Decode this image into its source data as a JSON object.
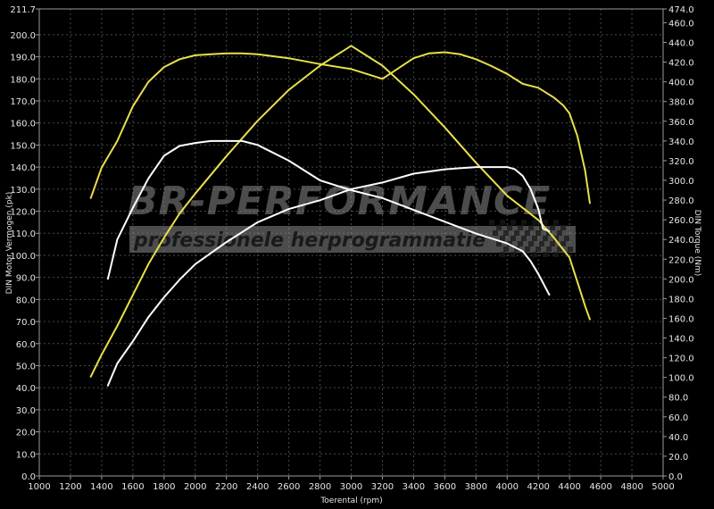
{
  "watermark": {
    "main": "BR-PERFORMANCE",
    "sub": "professionele herprogrammatie"
  },
  "colors": {
    "background": "#000000",
    "tuned": "#e8e04a",
    "stock": "#ffffff",
    "grid": "#4a4a4a"
  },
  "chart_data": {
    "type": "line",
    "xlabel": "Toerental (rpm)",
    "ylabel": "DIN Motor Vermogen (pk)",
    "y2label": "DIN Torque (Nm)",
    "xlim": [
      1000,
      5000
    ],
    "ylim": [
      0,
      211.7
    ],
    "y2lim": [
      0,
      474.0
    ],
    "x_ticks": [
      1000,
      1200,
      1400,
      1600,
      1800,
      2000,
      2200,
      2400,
      2600,
      2800,
      3000,
      3200,
      3400,
      3600,
      3800,
      4000,
      4200,
      4400,
      4600,
      4800,
      5000
    ],
    "y_ticks": [
      "0.0",
      "10.0",
      "20.0",
      "30.0",
      "40.0",
      "50.0",
      "60.0",
      "70.0",
      "80.0",
      "90.0",
      "100.0",
      "110.0",
      "120.0",
      "130.0",
      "140.0",
      "150.0",
      "160.0",
      "170.0",
      "180.0",
      "190.0",
      "200.0",
      "211.7"
    ],
    "y2_ticks": [
      "0.0",
      "20.0",
      "40.0",
      "60.0",
      "80.0",
      "100.0",
      "120.0",
      "140.0",
      "160.0",
      "180.0",
      "200.0",
      "220.0",
      "240.0",
      "260.0",
      "280.0",
      "300.0",
      "320.0",
      "340.0",
      "360.0",
      "380.0",
      "400.0",
      "420.0",
      "440.0",
      "460.0",
      "474.0"
    ],
    "grid": true,
    "series": [
      {
        "axis": "right",
        "color": "#e8e04a",
        "x": [
          1330,
          1400,
          1500,
          1600,
          1700,
          1800,
          1900,
          2000,
          2100,
          2200,
          2300,
          2400,
          2600,
          2800,
          3000,
          3200,
          3400,
          3500,
          3600,
          3700,
          3800,
          3900,
          4000,
          4100,
          4200,
          4300,
          4360,
          4400,
          4450,
          4500,
          4530
        ],
        "y": [
          282,
          313,
          340,
          375,
          400,
          415,
          423,
          427,
          428,
          429,
          429,
          428,
          424,
          418,
          413,
          403,
          424,
          429,
          430,
          428,
          423,
          416,
          408,
          398,
          394,
          384,
          376,
          368,
          345,
          310,
          277
        ]
      },
      {
        "axis": "left",
        "color": "#e8e04a",
        "x": [
          1330,
          1400,
          1500,
          1600,
          1700,
          1800,
          1900,
          2000,
          2200,
          2400,
          2600,
          2800,
          3000,
          3200,
          3400,
          3600,
          3800,
          4000,
          4200,
          4300,
          4400,
          4450,
          4500,
          4530
        ],
        "y": [
          45,
          55,
          68,
          82,
          96,
          108,
          119,
          128,
          145,
          161,
          175,
          186,
          195,
          186,
          173,
          158,
          142,
          127,
          116,
          108,
          99,
          88,
          77,
          71
        ]
      },
      {
        "axis": "right",
        "color": "#ffffff",
        "x": [
          1440,
          1500,
          1600,
          1700,
          1800,
          1900,
          2000,
          2100,
          2200,
          2300,
          2400,
          2600,
          2800,
          3000,
          3200,
          3400,
          3600,
          3800,
          4000,
          4100,
          4150,
          4200,
          4250,
          4270
        ],
        "y": [
          200,
          240,
          272,
          302,
          325,
          335,
          338,
          340,
          340,
          340,
          336,
          320,
          300,
          290,
          282,
          270,
          258,
          246,
          236,
          228,
          218,
          205,
          190,
          184
        ]
      },
      {
        "axis": "left",
        "color": "#ffffff",
        "x": [
          1440,
          1500,
          1600,
          1700,
          1800,
          1900,
          2000,
          2200,
          2400,
          2600,
          2800,
          3000,
          3200,
          3400,
          3600,
          3800,
          4000,
          4050,
          4100,
          4150,
          4200,
          4230,
          4270
        ],
        "y": [
          41,
          51,
          61,
          72,
          81,
          89,
          96,
          106,
          115,
          121,
          125,
          130,
          133,
          137,
          139,
          140,
          140,
          139,
          136,
          130,
          121,
          112,
          111
        ]
      }
    ]
  }
}
